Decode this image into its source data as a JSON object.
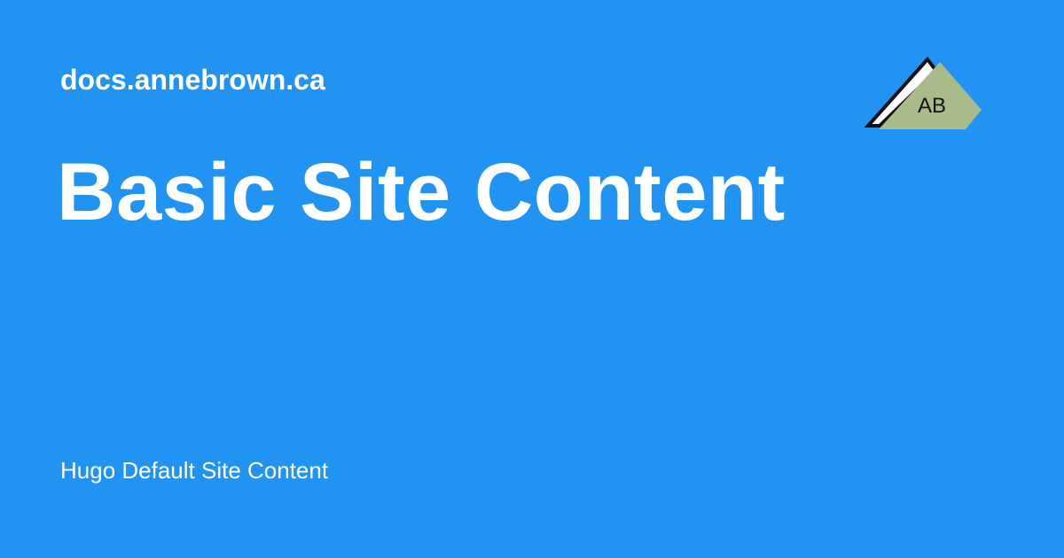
{
  "card": {
    "site_name": "docs.annebrown.ca",
    "title": "Basic Site Content",
    "description": "Hugo Default Site Content",
    "background_color": "#2093f3",
    "text_color": "#ffffff"
  },
  "logo": {
    "text": "AB",
    "fill_color": "#a9bb8a",
    "outline_color": "#111111"
  }
}
